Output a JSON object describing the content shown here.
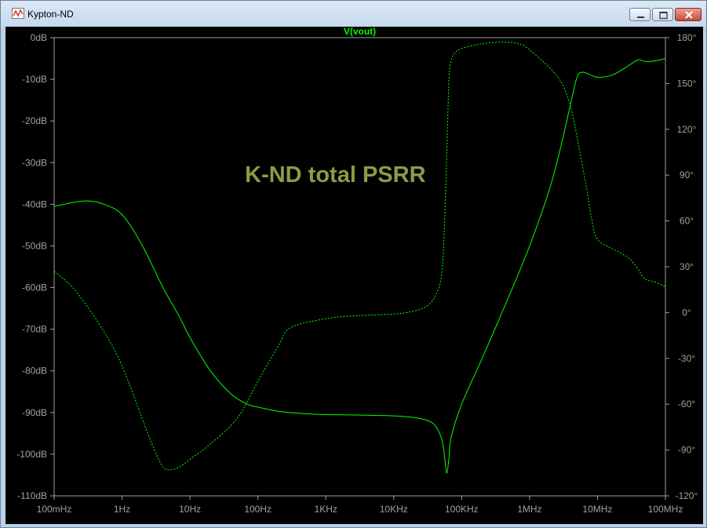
{
  "window": {
    "title": "Kypton-ND",
    "icons": {
      "app": "waveform-icon",
      "minimize": "minimize-icon",
      "maximize": "maximize-icon",
      "close": "close-icon"
    }
  },
  "chart_data": {
    "type": "line",
    "title": "V(vout)",
    "annotation": "K-ND total PSRR",
    "xscale": "log",
    "xlim": [
      0.1,
      100000000
    ],
    "ylim": [
      -110,
      0
    ],
    "y2lim": [
      -120,
      180
    ],
    "x_ticks": [
      "100mHz",
      "1Hz",
      "10Hz",
      "100Hz",
      "1KHz",
      "10KHz",
      "100KHz",
      "1MHz",
      "10MHz",
      "100MHz"
    ],
    "y_ticks": [
      "0dB",
      "-10dB",
      "-20dB",
      "-30dB",
      "-40dB",
      "-50dB",
      "-60dB",
      "-70dB",
      "-80dB",
      "-90dB",
      "-100dB",
      "-110dB"
    ],
    "y2_ticks": [
      "180°",
      "150°",
      "120°",
      "90°",
      "60°",
      "30°",
      "0°",
      "-30°",
      "-60°",
      "-90°",
      "-120°"
    ],
    "colors": {
      "trace": "#00ff00",
      "axis": "#a0a0a0",
      "text": "#a0a0a0",
      "annotation": "#8c9b47",
      "background": "#000000"
    },
    "series": [
      {
        "name": "V(vout) magnitude",
        "axis": "left",
        "style": "solid",
        "x": [
          0.1,
          0.2,
          0.3,
          0.5,
          1,
          2,
          4,
          7,
          10,
          20,
          40,
          70,
          100,
          200,
          500,
          1000,
          3000,
          10000,
          20000,
          30000,
          40000,
          50000,
          55000,
          60000,
          65000,
          70000,
          100000,
          200000,
          500000,
          1000000,
          2000000,
          3000000,
          4000000,
          5000000,
          6000000,
          8000000,
          10000000,
          15000000,
          20000000,
          30000000,
          40000000,
          50000000,
          70000000,
          100000000
        ],
        "y": [
          -40.5,
          -39.5,
          -39.2,
          -39.8,
          -42.5,
          -50,
          -60,
          -67,
          -72,
          -80,
          -85.5,
          -88,
          -88.7,
          -89.7,
          -90.3,
          -90.5,
          -90.6,
          -90.8,
          -91.2,
          -91.8,
          -93,
          -96,
          -99.5,
          -104.5,
          -101,
          -96,
          -88,
          -77,
          -62,
          -50,
          -36,
          -25,
          -16,
          -9.5,
          -8.3,
          -9,
          -9.5,
          -9.2,
          -8.3,
          -6.5,
          -5.3,
          -5.7,
          -5.6,
          -5
        ]
      },
      {
        "name": "V(vout) phase",
        "axis": "right",
        "style": "dashed",
        "x": [
          0.1,
          0.2,
          0.5,
          1,
          2,
          3,
          4,
          5,
          7,
          10,
          20,
          50,
          100,
          200,
          300,
          1000,
          3000,
          10000,
          20000,
          30000,
          40000,
          50000,
          55000,
          60000,
          65000,
          70000,
          80000,
          100000,
          200000,
          400000,
          700000,
          1000000,
          2000000,
          3000000,
          4000000,
          5000000,
          6000000,
          7000000,
          8000000,
          10000000,
          20000000,
          30000000,
          40000000,
          50000000,
          70000000,
          100000000
        ],
        "y": [
          27,
          15,
          -10,
          -35,
          -70,
          -90,
          -101,
          -103,
          -101,
          -96,
          -86,
          -69,
          -45,
          -22,
          -10,
          -4,
          -2,
          -1,
          1,
          4,
          10,
          23,
          50,
          100,
          152,
          165,
          170,
          173,
          176,
          177,
          176,
          172,
          160,
          150,
          135,
          115,
          96,
          80,
          64,
          48,
          40,
          35,
          28,
          22,
          20,
          17
        ]
      }
    ]
  }
}
